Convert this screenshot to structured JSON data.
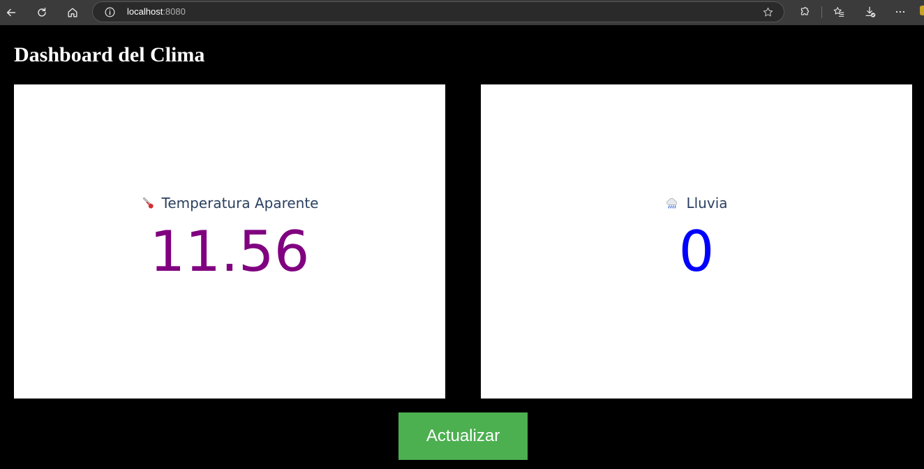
{
  "browser": {
    "url_host": "localhost",
    "url_port": ":8080"
  },
  "page": {
    "title": "Dashboard del Clima"
  },
  "cards": [
    {
      "label": "Temperatura Aparente",
      "value": "11.56",
      "icon": "thermometer-icon",
      "value_color": "#800080"
    },
    {
      "label": "Lluvia",
      "value": "0",
      "icon": "rain-cloud-icon",
      "value_color": "#0000ff"
    }
  ],
  "actions": {
    "update_label": "Actualizar",
    "update_color": "#4caf50"
  }
}
